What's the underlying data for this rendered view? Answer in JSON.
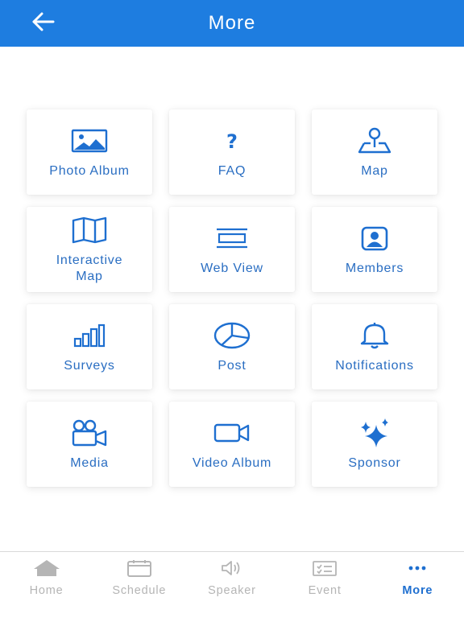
{
  "header": {
    "title": "More",
    "back_icon": "arrow-left-icon"
  },
  "tiles": [
    {
      "label": "Photo Album",
      "icon": "image-icon"
    },
    {
      "label": "FAQ",
      "icon": "question-icon"
    },
    {
      "label": "Map",
      "icon": "map-pin-icon"
    },
    {
      "label": "Interactive\nMap",
      "icon": "folded-map-icon"
    },
    {
      "label": "Web View",
      "icon": "web-view-icon"
    },
    {
      "label": "Members",
      "icon": "member-badge-icon"
    },
    {
      "label": "Surveys",
      "icon": "bar-chart-icon"
    },
    {
      "label": "Post",
      "icon": "pie-chart-icon"
    },
    {
      "label": "Notifications",
      "icon": "bell-icon"
    },
    {
      "label": "Media",
      "icon": "movie-camera-icon"
    },
    {
      "label": "Video Album",
      "icon": "video-camera-icon"
    },
    {
      "label": "Sponsor",
      "icon": "sparkles-icon"
    }
  ],
  "tabs": [
    {
      "label": "Home",
      "icon": "home-icon",
      "active": false
    },
    {
      "label": "Schedule",
      "icon": "calendar-icon",
      "active": false
    },
    {
      "label": "Speaker",
      "icon": "speaker-icon",
      "active": false
    },
    {
      "label": "Event",
      "icon": "ticket-icon",
      "active": false
    },
    {
      "label": "More",
      "icon": "more-dots-icon",
      "active": true
    }
  ],
  "colors": {
    "header_bg": "#1e7de0",
    "accent": "#1e6fd0",
    "tile_text": "#2a6ec2",
    "tab_inactive": "#b5b5b5"
  }
}
